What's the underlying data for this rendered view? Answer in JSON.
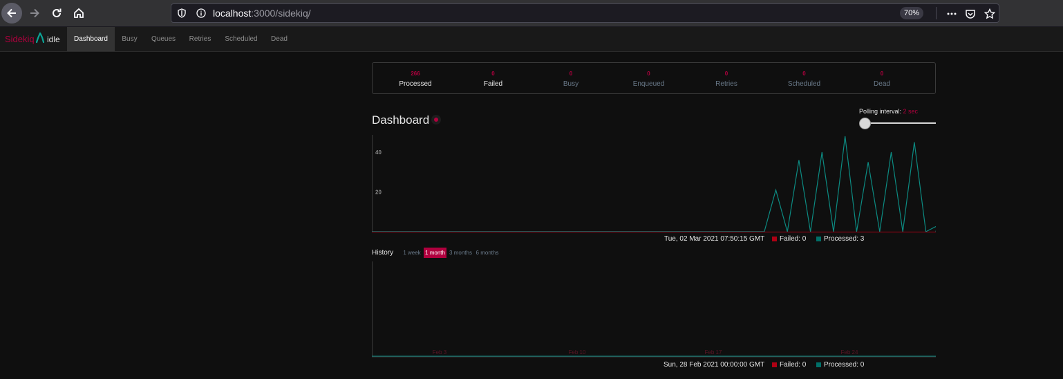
{
  "browser": {
    "url_host": "localhost",
    "url_path": ":3000/sidekiq/",
    "zoom": "70%",
    "icons": {
      "back": "arrow-left-icon",
      "forward": "arrow-right-icon",
      "reload": "reload-icon",
      "home": "home-icon",
      "tracking": "shield-icon",
      "info": "info-icon",
      "more": "ellipsis-icon",
      "pocket": "pocket-icon",
      "bookmark": "star-icon"
    }
  },
  "navbar": {
    "brand": "Sidekiq",
    "status": "idle",
    "items": [
      {
        "label": "Dashboard",
        "active": true
      },
      {
        "label": "Busy",
        "active": false
      },
      {
        "label": "Queues",
        "active": false
      },
      {
        "label": "Retries",
        "active": false
      },
      {
        "label": "Scheduled",
        "active": false
      },
      {
        "label": "Dead",
        "active": false
      }
    ]
  },
  "summary": [
    {
      "count": "266",
      "label": "Processed"
    },
    {
      "count": "0",
      "label": "Failed"
    },
    {
      "count": "0",
      "label": "Busy"
    },
    {
      "count": "0",
      "label": "Enqueued"
    },
    {
      "count": "0",
      "label": "Retries"
    },
    {
      "count": "0",
      "label": "Scheduled"
    },
    {
      "count": "0",
      "label": "Dead"
    }
  ],
  "dashboard": {
    "title": "Dashboard",
    "polling_label": "Polling interval:",
    "polling_value": "2 sec"
  },
  "colors": {
    "accent": "#b1003e",
    "failed": "#af0014",
    "processed": "#006f68"
  },
  "chart_data": [
    {
      "type": "line",
      "name": "realtime",
      "y_ticks": [
        "20",
        "40"
      ],
      "ylim": [
        0,
        48
      ],
      "series": [
        {
          "name": "Failed",
          "values": [
            0,
            0,
            0,
            0,
            0,
            0,
            0,
            0,
            0,
            0,
            0,
            0,
            0,
            0,
            0,
            0,
            0,
            0,
            0,
            0,
            0,
            0,
            0,
            0,
            0,
            0,
            0,
            0,
            0,
            0,
            0,
            0,
            0,
            0,
            0,
            0,
            0,
            0,
            0,
            0,
            0,
            0,
            0,
            0,
            0,
            0,
            0,
            0,
            0,
            0
          ]
        },
        {
          "name": "Processed",
          "values": [
            0,
            0,
            0,
            0,
            0,
            0,
            0,
            0,
            0,
            0,
            0,
            0,
            0,
            0,
            0,
            0,
            0,
            0,
            0,
            0,
            0,
            0,
            0,
            0,
            0,
            0,
            0,
            0,
            0,
            0,
            0,
            0,
            0,
            0,
            0,
            21,
            0,
            36,
            0,
            40,
            0,
            48,
            0,
            35,
            0,
            40,
            0,
            45,
            0,
            3
          ]
        }
      ],
      "hover": {
        "date": "Tue, 02 Mar 2021 07:50:15 GMT",
        "failed_label": "Failed: 0",
        "processed_label": "Processed: 3"
      }
    },
    {
      "type": "line",
      "name": "history",
      "x_ticks": [
        "Feb 3",
        "Feb 10",
        "Feb 17",
        "Feb 24"
      ],
      "series": [
        {
          "name": "Failed",
          "values": [
            0,
            0,
            0,
            0,
            0,
            0,
            0,
            0,
            0,
            0,
            0,
            0,
            0,
            0,
            0,
            0,
            0,
            0,
            0,
            0,
            0,
            0,
            0,
            0,
            0,
            0,
            0,
            0,
            0,
            0
          ]
        },
        {
          "name": "Processed",
          "values": [
            0,
            0,
            0,
            0,
            0,
            0,
            0,
            0,
            0,
            0,
            0,
            0,
            0,
            0,
            0,
            0,
            0,
            0,
            0,
            0,
            0,
            0,
            0,
            0,
            0,
            0,
            0,
            0,
            0,
            0
          ]
        }
      ],
      "hover": {
        "date": "Sun, 28 Feb 2021 00:00:00 GMT",
        "failed_label": "Failed: 0",
        "processed_label": "Processed: 0"
      }
    }
  ],
  "history": {
    "title": "History",
    "ranges": [
      {
        "label": "1 week",
        "active": false
      },
      {
        "label": "1 month",
        "active": true
      },
      {
        "label": "3 months",
        "active": false
      },
      {
        "label": "6 months",
        "active": false
      }
    ]
  }
}
